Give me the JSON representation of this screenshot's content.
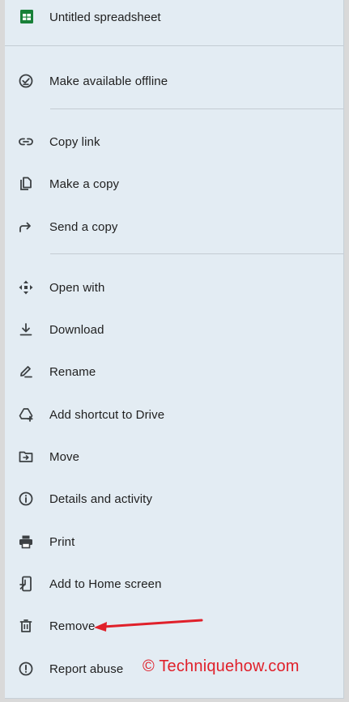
{
  "header": {
    "title": "Untitled spreadsheet",
    "icon": "google-sheets-icon",
    "icon_color": "#188038"
  },
  "menu": {
    "items": [
      {
        "key": "offline",
        "label": "Make available offline",
        "icon": "offline-check-icon"
      },
      {
        "key": "copy-link",
        "label": "Copy link",
        "icon": "link-icon"
      },
      {
        "key": "make-copy",
        "label": "Make a copy",
        "icon": "copy-icon"
      },
      {
        "key": "send-copy",
        "label": "Send a copy",
        "icon": "share-arrow-icon"
      },
      {
        "key": "open-with",
        "label": "Open with",
        "icon": "open-with-icon"
      },
      {
        "key": "download",
        "label": "Download",
        "icon": "download-icon"
      },
      {
        "key": "rename",
        "label": "Rename",
        "icon": "rename-pencil-icon"
      },
      {
        "key": "add-shortcut",
        "label": "Add shortcut to Drive",
        "icon": "drive-shortcut-icon"
      },
      {
        "key": "move",
        "label": "Move",
        "icon": "move-folder-icon"
      },
      {
        "key": "details",
        "label": "Details and activity",
        "icon": "info-icon"
      },
      {
        "key": "print",
        "label": "Print",
        "icon": "print-icon"
      },
      {
        "key": "home-screen",
        "label": "Add to Home screen",
        "icon": "add-to-home-icon"
      },
      {
        "key": "remove",
        "label": "Remove",
        "icon": "trash-icon"
      },
      {
        "key": "report",
        "label": "Report abuse",
        "icon": "report-icon"
      }
    ]
  },
  "watermark": {
    "text": "© Techniquehow.com",
    "color": "#e0202a"
  },
  "colors": {
    "background": "#e3ecf3",
    "text": "#1f1f1f",
    "icon": "#3c4043",
    "annotation_arrow": "#e0202a"
  }
}
